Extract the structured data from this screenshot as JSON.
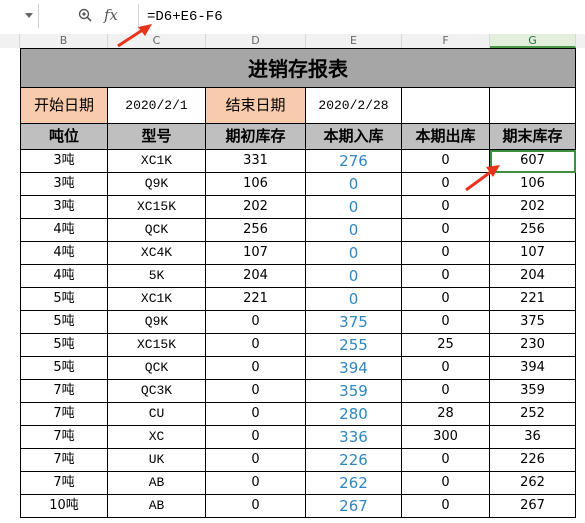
{
  "formula_bar": {
    "name_box": "",
    "fx_label": "fx",
    "formula": "=D6+E6-F6"
  },
  "columns": [
    "B",
    "C",
    "D",
    "E",
    "F",
    "G"
  ],
  "selected_column": "G",
  "sheet": {
    "title": "进销存报表",
    "start_label": "开始日期",
    "start_value": "2020/2/1",
    "end_label": "结束日期",
    "end_value": "2020/2/28",
    "headers": [
      "吨位",
      "型号",
      "期初库存",
      "本期入库",
      "本期出库",
      "期末库存"
    ],
    "rows": [
      [
        "3吨",
        "XC1K",
        "331",
        "276",
        "0",
        "607"
      ],
      [
        "3吨",
        "Q9K",
        "106",
        "0",
        "0",
        "106"
      ],
      [
        "3吨",
        "XC15K",
        "202",
        "0",
        "0",
        "202"
      ],
      [
        "4吨",
        "QCK",
        "256",
        "0",
        "0",
        "256"
      ],
      [
        "4吨",
        "XC4K",
        "107",
        "0",
        "0",
        "107"
      ],
      [
        "4吨",
        "5K",
        "204",
        "0",
        "0",
        "204"
      ],
      [
        "5吨",
        "XC1K",
        "221",
        "0",
        "0",
        "221"
      ],
      [
        "5吨",
        "Q9K",
        "0",
        "375",
        "0",
        "375"
      ],
      [
        "5吨",
        "XC15K",
        "0",
        "255",
        "25",
        "230"
      ],
      [
        "5吨",
        "QCK",
        "0",
        "394",
        "0",
        "394"
      ],
      [
        "7吨",
        "QC3K",
        "0",
        "359",
        "0",
        "359"
      ],
      [
        "7吨",
        "CU",
        "0",
        "280",
        "28",
        "252"
      ],
      [
        "7吨",
        "XC",
        "0",
        "336",
        "300",
        "36"
      ],
      [
        "7吨",
        "UK",
        "0",
        "226",
        "0",
        "226"
      ],
      [
        "7吨",
        "AB",
        "0",
        "262",
        "0",
        "262"
      ],
      [
        "10吨",
        "AB",
        "0",
        "267",
        "0",
        "267"
      ]
    ]
  },
  "colors": {
    "title_bg": "#a6a6a6",
    "header_bg": "#bfbfbf",
    "date_label_bg": "#f8cbad",
    "inbound_text": "#2e86c1",
    "arrow": "#e8341c",
    "selection": "#3d8f3d"
  }
}
